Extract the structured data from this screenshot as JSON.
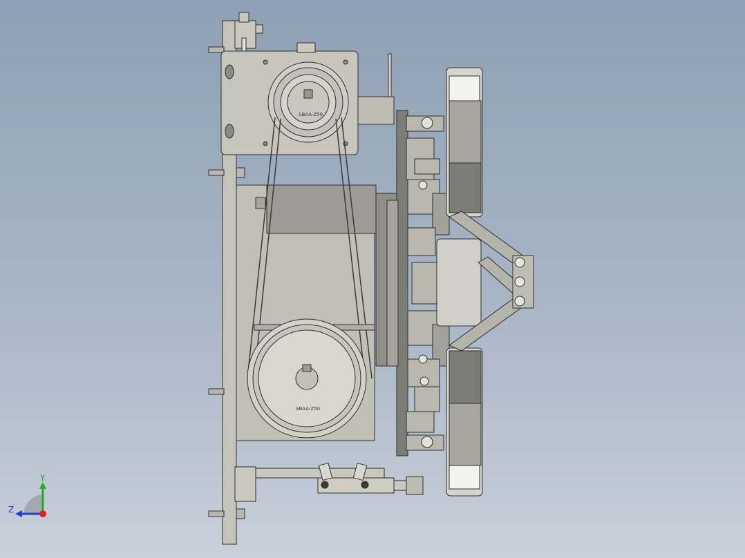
{
  "viewport": {
    "name": "3D model graphics area",
    "background_top": "#8ea0b5",
    "background_bottom": "#c8d0da"
  },
  "model": {
    "part_color": "#c9c9c0",
    "edge_color": "#2e2e2e",
    "dark_part_color": "#6f6f6a",
    "upper_pulley_label": "SBAA-Z50",
    "lower_pulley_label": "SBAA-Z50"
  },
  "triad": {
    "x_label": "",
    "y_label": "Y",
    "z_label": "Z",
    "x_color": "#e02020",
    "y_color": "#20b020",
    "z_color": "#2040d0"
  }
}
